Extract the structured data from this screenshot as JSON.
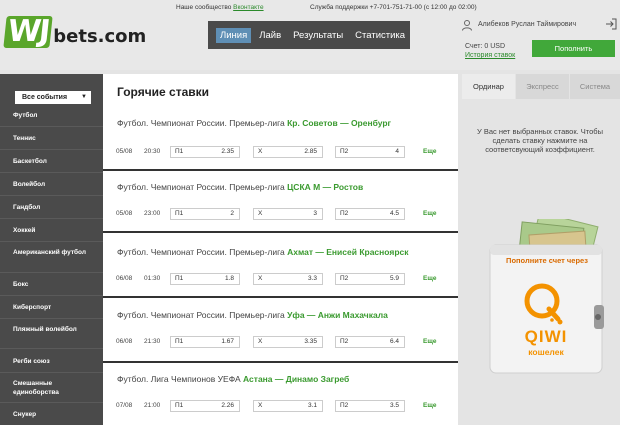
{
  "header": {
    "logo_wj": "WJ",
    "logo_bets": "bets.com",
    "community_label": "Наше сообщество",
    "community_link": "Вконтакте",
    "support": "Служба поддержки +7-701-751-71-00 (с 12:00 до 02:00)",
    "nav": [
      "Линия",
      "Лайв",
      "Результаты",
      "Статистика"
    ],
    "user_name": "Алибеков Руслан Таймирович",
    "balance": "Счет: 0 USD",
    "history": "История ставок",
    "topup": "Пополнить"
  },
  "sidebar": {
    "select_label": "Все события",
    "items": [
      "Футбол",
      "Теннис",
      "Баскетбол",
      "Волейбол",
      "Гандбол",
      "Хоккей",
      "Американский футбол",
      "Бокс",
      "Киберспорт",
      "Пляжный волейбол",
      "Регби союз",
      "Смешанные единоборства",
      "Снукер"
    ]
  },
  "main": {
    "title": "Горячие ставки",
    "events": [
      {
        "league": "Футбол. Чемпионат России. Премьер-лига",
        "teams": "Кр. Советов — Оренбург",
        "date": "05/08",
        "time": "20:30",
        "o1_label": "П1",
        "o1": "2.35",
        "ox_label": "Х",
        "ox": "2.85",
        "o2_label": "П2",
        "o2": "4",
        "more": "Еще"
      },
      {
        "league": "Футбол. Чемпионат России. Премьер-лига",
        "teams": "ЦСКА М — Ростов",
        "date": "05/08",
        "time": "23:00",
        "o1_label": "П1",
        "o1": "2",
        "ox_label": "Х",
        "ox": "3",
        "o2_label": "П2",
        "o2": "4.5",
        "more": "Еще"
      },
      {
        "league": "Футбол. Чемпионат России. Премьер-лига",
        "teams": "Ахмат — Енисей Красноярск",
        "date": "06/08",
        "time": "01:30",
        "o1_label": "П1",
        "o1": "1.8",
        "ox_label": "Х",
        "ox": "3.3",
        "o2_label": "П2",
        "o2": "5.9",
        "more": "Еще"
      },
      {
        "league": "Футбол. Чемпионат России. Премьер-лига",
        "teams": "Уфа — Анжи Махачкала",
        "date": "06/08",
        "time": "21:30",
        "o1_label": "П1",
        "o1": "1.67",
        "ox_label": "Х",
        "ox": "3.35",
        "o2_label": "П2",
        "o2": "6.4",
        "more": "Еще"
      },
      {
        "league": "Футбол. Лига Чемпионов УЕФА",
        "teams": "Астана — Динамо Загреб",
        "date": "07/08",
        "time": "21:00",
        "o1_label": "П1",
        "o1": "2.26",
        "ox_label": "Х",
        "ox": "3.1",
        "o2_label": "П2",
        "o2": "3.5",
        "more": "Еще"
      }
    ]
  },
  "right": {
    "tabs": [
      "Ординар",
      "Экспресс",
      "Система"
    ],
    "empty_message": "У Вас нет выбранных ставок. Чтобы сделать ставку нажмите на соответсвующий коэффициент.",
    "wallet_text": "Пополните счет через",
    "qiwi": "QIWI",
    "qiwi_sub": "кошелек"
  },
  "colors": {
    "accent_green": "#41a83a",
    "nav_bg": "#4a4a4a",
    "nav_active": "#5f8fb5"
  }
}
